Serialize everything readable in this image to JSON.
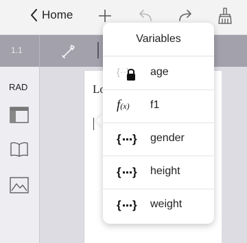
{
  "nav": {
    "back_label": "Home"
  },
  "strip": {
    "page_number": "1.1"
  },
  "sidebar": {
    "mode": "RAD"
  },
  "document": {
    "text_fragment": "Lo"
  },
  "popover": {
    "title": "Variables",
    "items": [
      {
        "name": "age",
        "icon": "locked-variable-icon"
      },
      {
        "name": "f1",
        "icon": "function-icon"
      },
      {
        "name": "gender",
        "icon": "variable-braces-icon"
      },
      {
        "name": "height",
        "icon": "variable-braces-icon"
      },
      {
        "name": "weight",
        "icon": "variable-braces-icon"
      }
    ]
  },
  "colors": {
    "strip": "#a3a1ab",
    "popover": "#ffffff",
    "background": "#e9e9ee"
  }
}
